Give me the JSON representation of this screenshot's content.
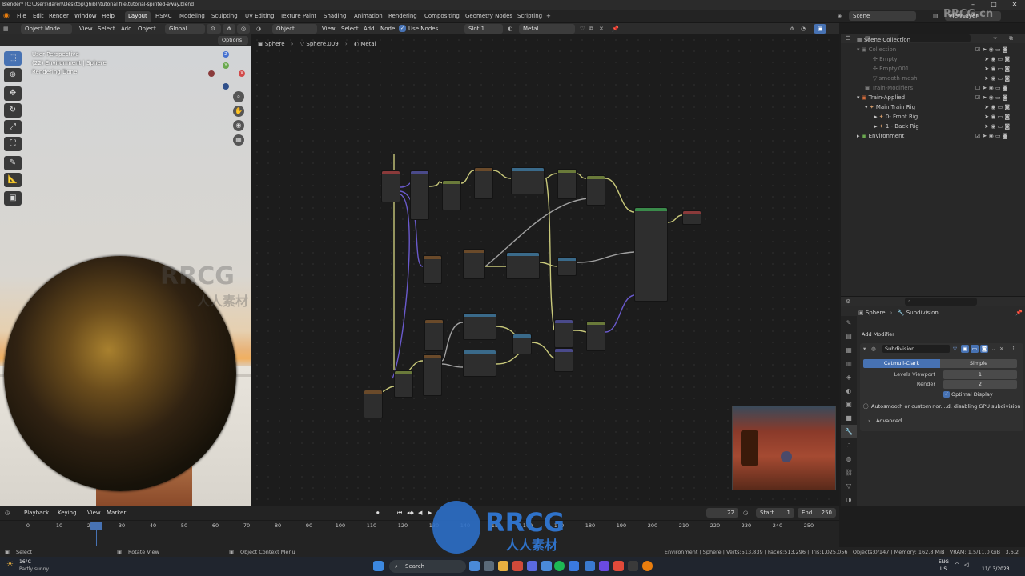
{
  "window": {
    "title": "Blender* [C:\\Users\\daren\\Desktop\\ghibli\\tutorial file\\tutorial-spirited-away.blend]",
    "controls": [
      "–",
      "□",
      "✕"
    ]
  },
  "menubar": {
    "items": [
      "File",
      "Edit",
      "Render",
      "Window",
      "Help"
    ],
    "workspaces": [
      "Layout",
      "HSMC",
      "Modeling",
      "Sculpting",
      "UV Editing",
      "Texture Paint",
      "Shading",
      "Animation",
      "Rendering",
      "Compositing",
      "Geometry Nodes",
      "Scripting"
    ],
    "active_workspace": "Layout",
    "add_tab": "+",
    "scene": "Scene",
    "view_layer": "ViewLayer"
  },
  "viewport_header": {
    "mode": "Object Mode",
    "menus": [
      "View",
      "Select",
      "Add",
      "Object"
    ],
    "transform_orientation": "Global",
    "options_label": "Options"
  },
  "viewport": {
    "info_lines": [
      "User Perspective",
      "(22) Environment | Sphere",
      "Rendering Done"
    ],
    "gizmo_axes": [
      "Z",
      "Y",
      "X"
    ]
  },
  "node_editor_header": {
    "type": "Object",
    "menus": [
      "View",
      "Select",
      "Add",
      "Node"
    ],
    "use_nodes_label": "Use Nodes",
    "slot": "Slot 1",
    "material": "Metal",
    "breadcrumb": [
      "Sphere",
      "Sphere.009",
      "Metal"
    ]
  },
  "outliner": {
    "header": "Scene Collection",
    "rows": [
      {
        "label": "Collection",
        "dim": true
      },
      {
        "label": "Empty",
        "dim": true
      },
      {
        "label": "Empty.001",
        "dim": true
      },
      {
        "label": "smooth-mesh",
        "dim": true
      },
      {
        "label": "Train-Modifiers",
        "dim": true
      },
      {
        "label": "Train-Applied",
        "dim": false
      },
      {
        "label": "Main Train Rig",
        "dim": false
      },
      {
        "label": "0- Front Rig",
        "dim": false
      },
      {
        "label": "1 - Back Rig",
        "dim": false
      },
      {
        "label": "Environment",
        "dim": false
      }
    ]
  },
  "properties": {
    "object": "Sphere",
    "modifier_tab": "Subdivision",
    "add_modifier_label": "Add Modifier",
    "modifier_name": "Subdivision",
    "algorithms": [
      "Catmull-Clark",
      "Simple"
    ],
    "active_algorithm": "Catmull-Clark",
    "levels_viewport_label": "Levels Viewport",
    "levels_viewport_value": "1",
    "render_label": "Render",
    "render_value": "2",
    "optimal_display_label": "Optimal Display",
    "warning": "Autosmooth or custom nor....d, disabling GPU subdivision",
    "advanced_label": "Advanced"
  },
  "timeline": {
    "menus": [
      "Playback",
      "Keying",
      "View",
      "Marker"
    ],
    "current_frame": "22",
    "start_label": "Start",
    "start_value": "1",
    "end_label": "End",
    "end_value": "250",
    "ticks": [
      "0",
      "10",
      "20",
      "30",
      "40",
      "50",
      "60",
      "70",
      "80",
      "90",
      "100",
      "110",
      "120",
      "130",
      "140",
      "150",
      "160",
      "170",
      "180",
      "190",
      "200",
      "210",
      "220",
      "230",
      "240",
      "250"
    ]
  },
  "statusbar": {
    "left": [
      "Select",
      "Rotate View",
      "Object Context Menu"
    ],
    "stats": "Environment | Sphere | Verts:513,839 | Faces:513,296 | Tris:1,025,056 | Objects:0/147 | Memory: 162.8 MiB | VRAM: 1.5/11.0 GiB | 3.6.2"
  },
  "taskbar": {
    "weather_temp": "16°C",
    "weather_desc": "Partly sunny",
    "search_placeholder": "Search",
    "lang": "ENG",
    "region": "US",
    "time": "",
    "date": "11/13/2023"
  },
  "watermark": {
    "brand": "RRCG",
    "subtitle": "人人素材",
    "corner": "RRCG.cn"
  },
  "colors": {
    "accent": "#4772b3",
    "link_yellow": "#c8c87a",
    "link_purple": "#6a5acd",
    "link_gray": "#a0a0a0"
  }
}
